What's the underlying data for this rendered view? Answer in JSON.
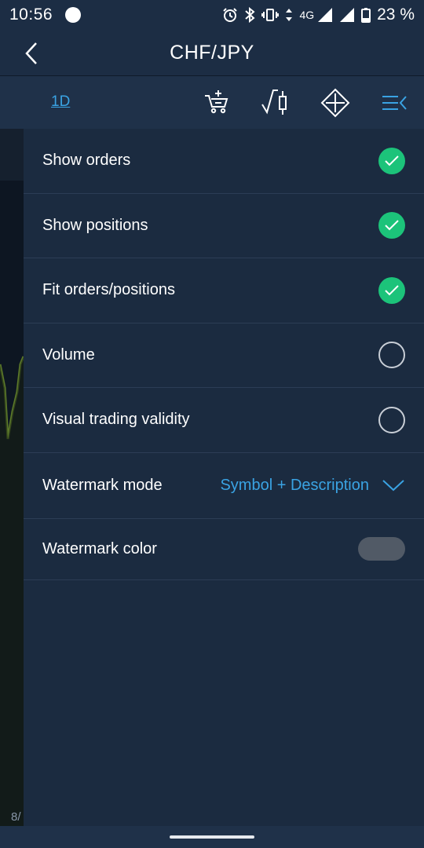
{
  "status_bar": {
    "time": "10:56",
    "network": "4G",
    "battery": "23 %"
  },
  "app_bar": {
    "title": "CHF/JPY"
  },
  "toolbar": {
    "timeframe": "1D",
    "icons": [
      "cart-add-icon",
      "indicator-icon",
      "move-arrows-icon",
      "menu-collapse-icon"
    ]
  },
  "chart": {
    "date_label": "8/"
  },
  "settings": {
    "show_orders": {
      "label": "Show orders",
      "checked": true
    },
    "show_positions": {
      "label": "Show positions",
      "checked": true
    },
    "fit_orders_positions": {
      "label": "Fit orders/positions",
      "checked": true
    },
    "volume": {
      "label": "Volume",
      "checked": false
    },
    "visual_trading_validity": {
      "label": "Visual trading validity",
      "checked": false
    },
    "watermark_mode": {
      "label": "Watermark mode",
      "value": "Symbol + Description"
    },
    "watermark_color": {
      "label": "Watermark color",
      "color": "#515a66"
    }
  },
  "colors": {
    "accent": "#3aa3e3",
    "check_green": "#1cc37a",
    "panel_bg": "#1b2b40"
  }
}
